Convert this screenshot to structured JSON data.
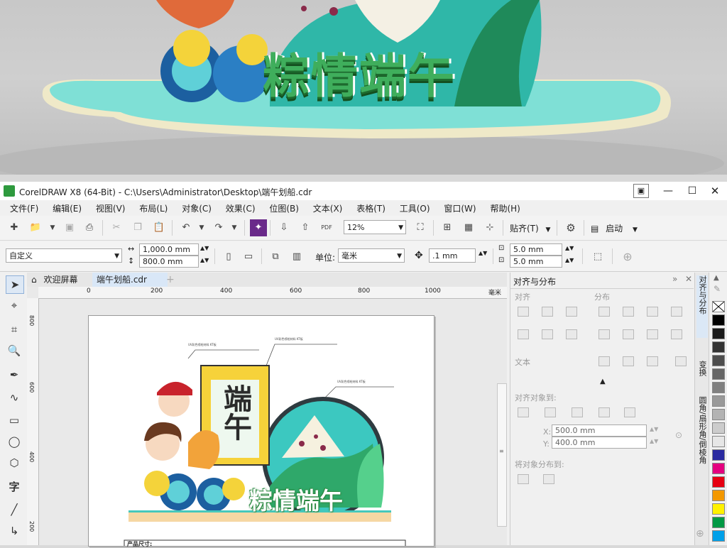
{
  "preview": {
    "title": "粽情端午"
  },
  "window": {
    "title": "CorelDRAW X8 (64-Bit) - C:\\Users\\Administrator\\Desktop\\端午划船.cdr",
    "controls": [
      "—",
      "☐",
      "✕"
    ]
  },
  "menu": [
    "文件(F)",
    "编辑(E)",
    "视图(V)",
    "布局(L)",
    "对象(C)",
    "效果(C)",
    "位图(B)",
    "文本(X)",
    "表格(T)",
    "工具(O)",
    "窗口(W)",
    "帮助(H)"
  ],
  "toolbar": {
    "zoom": "12%",
    "snap_label": "贴齐(T)",
    "launch_label": "启动",
    "pdf_label": "PDF"
  },
  "propbar": {
    "preset": "自定义",
    "width": "1,000.0 mm",
    "height": "800.0 mm",
    "unit_label": "单位:",
    "unit": "毫米",
    "nudge": ".1 mm",
    "dup_x": "5.0 mm",
    "dup_y": "5.0 mm"
  },
  "doc_tabs": [
    "欢迎屏幕",
    "端午划船.cdr"
  ],
  "ruler": {
    "h_ticks": [
      "0",
      "200",
      "400",
      "600",
      "800",
      "1000"
    ],
    "h_unit": "毫米",
    "v_ticks": [
      "800",
      "600",
      "400",
      "200"
    ]
  },
  "artwork": {
    "title": "粽情端午",
    "sign_text": "端午",
    "callouts": [
      "UV彩色喷绘材料 KT板",
      "UV彩色喷绘材料 KT板",
      "UV彩色喷绘材料 KT板"
    ],
    "footer_label": "产品尺寸:"
  },
  "docker": {
    "title": "对齐与分布",
    "align": "对齐",
    "distribute": "分布",
    "text": "文本",
    "align_to": "对齐对象到:",
    "x": "500.0 mm",
    "y": "400.0 mm",
    "x_label": "X:",
    "y_label": "Y:",
    "distribute_to": "将对象分布到:"
  },
  "vertical_tabs": [
    "对齐与分布",
    "变换",
    "圆角/扇形角/倒棱角"
  ],
  "palette": [
    "#ffffff",
    "#000000",
    "#1a1a1a",
    "#333333",
    "#4d4d4d",
    "#666666",
    "#808080",
    "#999999",
    "#b3b3b3",
    "#cccccc",
    "#e6e6e6",
    "#2a2aa0",
    "#e4007f",
    "#e60012",
    "#f39800",
    "#fff100",
    "#009944",
    "#00a0e9"
  ],
  "colors": {
    "accent_green": "#3fae5c",
    "coral_logo": "#27a34a",
    "teal": "#3cc8c0"
  }
}
